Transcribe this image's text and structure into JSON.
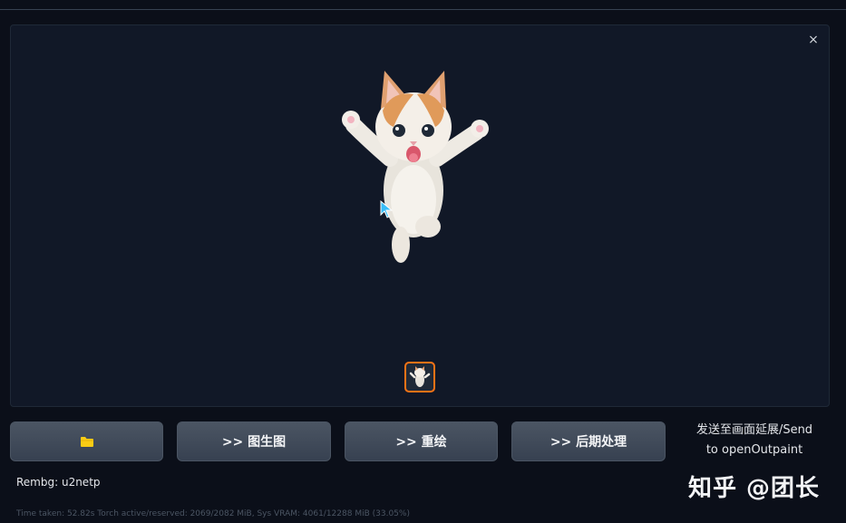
{
  "gallery": {
    "close_label": "×",
    "preview_alt": "cat image with background removed"
  },
  "buttons": {
    "open_folder_icon": "folder-icon",
    "img2img_label": ">> 图生图",
    "inpaint_label": ">> 重绘",
    "extras_label": ">> 后期处理"
  },
  "send_outpaint": {
    "line1": "发送至画面延展/Send",
    "line2": "to openOutpaint"
  },
  "status": {
    "rembg": "Rembg: u2netp",
    "footer": "Time taken: 52.82s  Torch active/reserved: 2069/2082 MiB, Sys VRAM: 4061/12288 MiB (33.05%)"
  },
  "watermark": "知乎 @团长",
  "colors": {
    "accent_thumb_border": "#f97316",
    "folder_icon": "#facc15",
    "background": "#0b0f19",
    "panel": "#111827"
  }
}
